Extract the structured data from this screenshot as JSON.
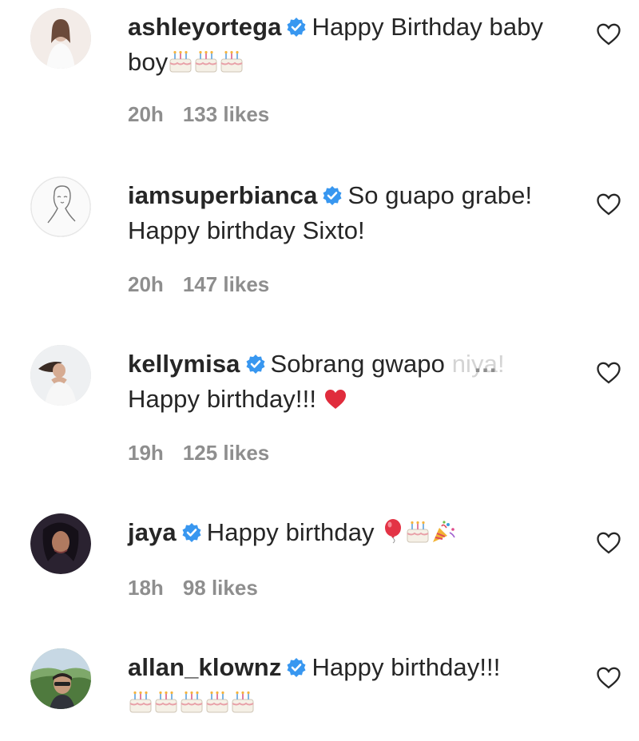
{
  "comments": [
    {
      "username": "ashleyortega",
      "text": "Happy Birthday baby boy",
      "emojis": [
        "birthday-cake",
        "birthday-cake",
        "birthday-cake"
      ],
      "time": "20h",
      "likes": "133 likes"
    },
    {
      "username": "iamsuperbianca",
      "text": "So guapo grabe! Happy birthday Sixto!",
      "time": "20h",
      "likes": "147 likes"
    },
    {
      "username": "kellymisa",
      "text_line1": "Sobrang gwapo",
      "text_faded": "niya!",
      "more": "...",
      "text_line2": "Happy birthday!!!",
      "emojis": [
        "red-heart"
      ],
      "time": "19h",
      "likes": "125 likes"
    },
    {
      "username": "jaya",
      "text": "Happy birthday",
      "emojis": [
        "balloon",
        "birthday-cake",
        "party-popper"
      ],
      "time": "18h",
      "likes": "98 likes"
    },
    {
      "username": "allan_klownz",
      "text": "Happy birthday!!!",
      "emojis": [
        "birthday-cake",
        "birthday-cake",
        "birthday-cake",
        "birthday-cake",
        "birthday-cake"
      ]
    }
  ],
  "colors": {
    "verified": "#3897f0",
    "meta_text": "#8e8e8e",
    "primary_text": "#262626"
  }
}
